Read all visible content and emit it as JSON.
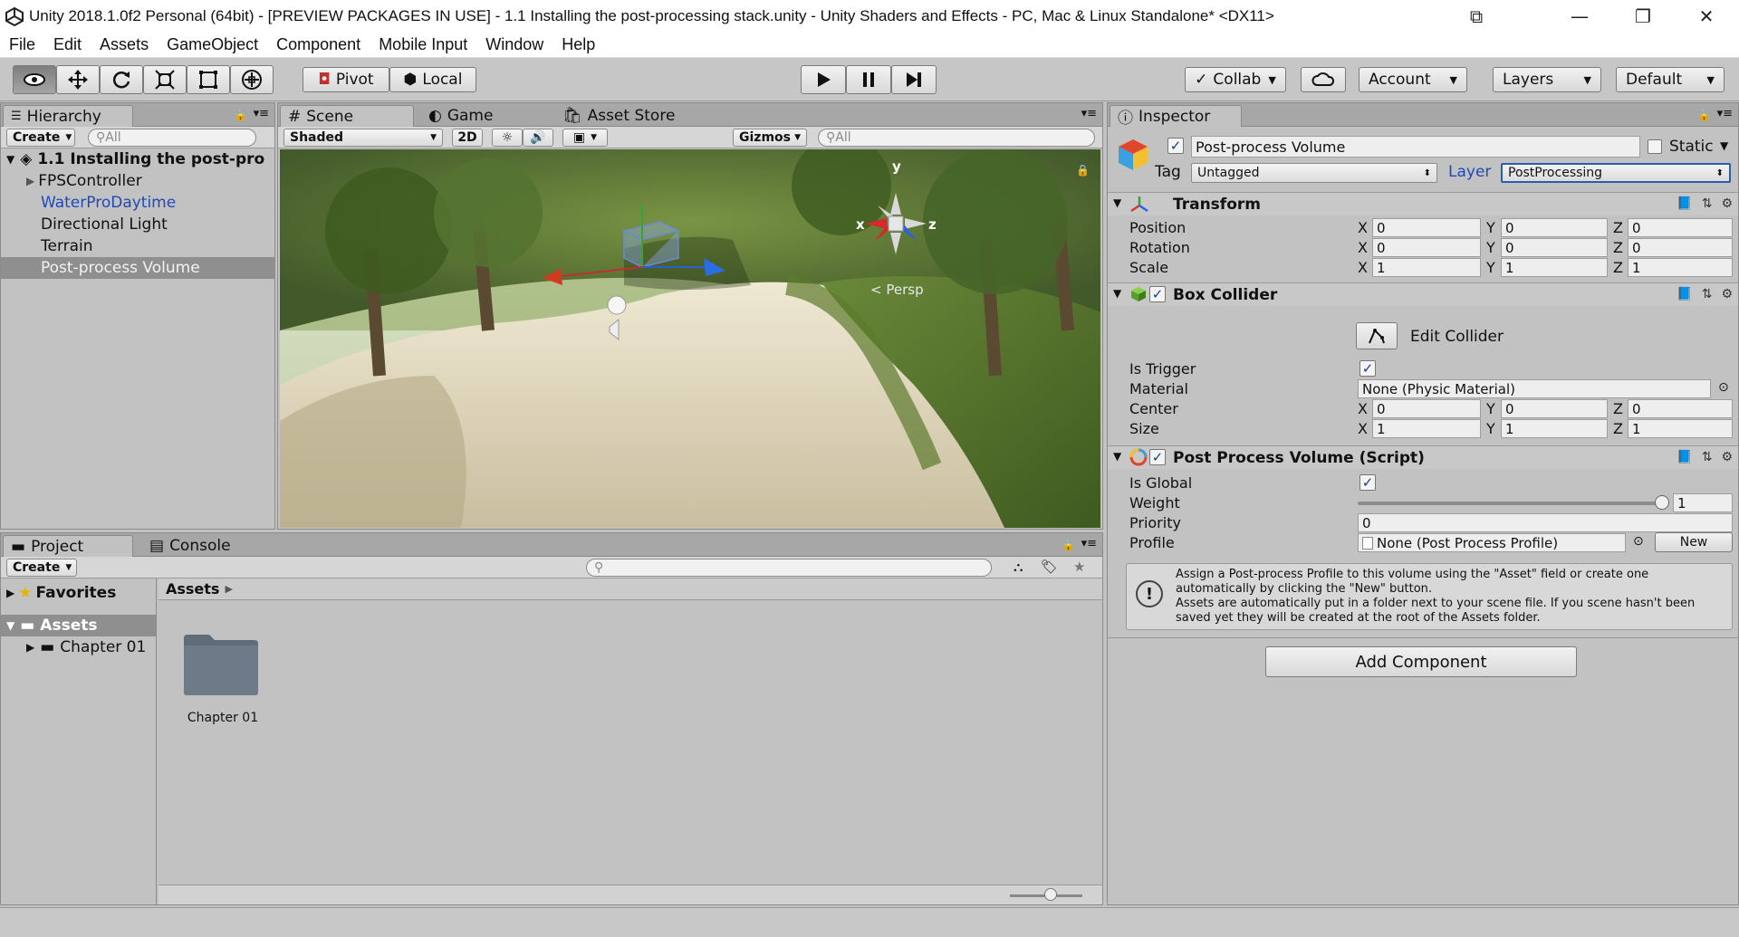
{
  "window": {
    "title": "Unity 2018.1.0f2 Personal (64bit) - [PREVIEW PACKAGES IN USE] - 1.1 Installing the post-processing stack.unity - Unity Shaders and Effects - PC, Mac & Linux Standalone* <DX11>"
  },
  "menu": [
    "File",
    "Edit",
    "Assets",
    "GameObject",
    "Component",
    "Mobile Input",
    "Window",
    "Help"
  ],
  "toolbar": {
    "pivot": "Pivot",
    "local": "Local",
    "collab": "Collab",
    "account": "Account",
    "layers": "Layers",
    "layout": "Default"
  },
  "hierarchy": {
    "tab": "Hierarchy",
    "create": "Create",
    "search": "All",
    "scene": "1.1 Installing the post-pro",
    "items": [
      "FPSController",
      "WaterProDaytime",
      "Directional Light",
      "Terrain",
      "Post-process Volume"
    ]
  },
  "scene": {
    "tabs": [
      "Scene",
      "Game",
      "Asset Store"
    ],
    "shading": "Shaded",
    "mode2d": "2D",
    "gizmos": "Gizmos",
    "search": "All",
    "persp": "Persp",
    "axes": {
      "x": "x",
      "y": "y",
      "z": "z"
    }
  },
  "project": {
    "tabs": [
      "Project",
      "Console"
    ],
    "create": "Create",
    "favorites": "Favorites",
    "assets": "Assets",
    "folder": "Chapter 01",
    "breadcrumb": "Assets"
  },
  "inspector": {
    "tab": "Inspector",
    "object_name": "Post-process Volume",
    "static": "Static",
    "tag_label": "Tag",
    "tag": "Untagged",
    "layer_label": "Layer",
    "layer": "PostProcessing",
    "transform": {
      "title": "Transform",
      "position_label": "Position",
      "rotation_label": "Rotation",
      "scale_label": "Scale",
      "position": [
        "0",
        "0",
        "0"
      ],
      "rotation": [
        "0",
        "0",
        "0"
      ],
      "scale": [
        "1",
        "1",
        "1"
      ]
    },
    "box_collider": {
      "title": "Box Collider",
      "edit": "Edit Collider",
      "is_trigger": "Is Trigger",
      "material_label": "Material",
      "material": "None (Physic Material)",
      "center_label": "Center",
      "size_label": "Size",
      "center": [
        "0",
        "0",
        "0"
      ],
      "size": [
        "1",
        "1",
        "1"
      ]
    },
    "ppv": {
      "title": "Post Process Volume (Script)",
      "is_global": "Is Global",
      "weight_label": "Weight",
      "weight": "1",
      "weight_fraction": 1.0,
      "priority_label": "Priority",
      "priority": "0",
      "profile_label": "Profile",
      "profile": "None (Post Process Profile)",
      "new": "New"
    },
    "help": "Assign a Post-process Profile to this volume using the \"Asset\" field or create one automatically by clicking the \"New\" button.\nAssets are automatically put in a folder next to your scene file. If you scene hasn't been saved yet they will be created at the root of the Assets folder.",
    "add_component": "Add Component"
  },
  "axis_letters": [
    "X",
    "Y",
    "Z"
  ],
  "colors": {
    "selection": "#8f8f8f",
    "blue_text": "#1f49b8",
    "accent": "#2a5db0"
  }
}
